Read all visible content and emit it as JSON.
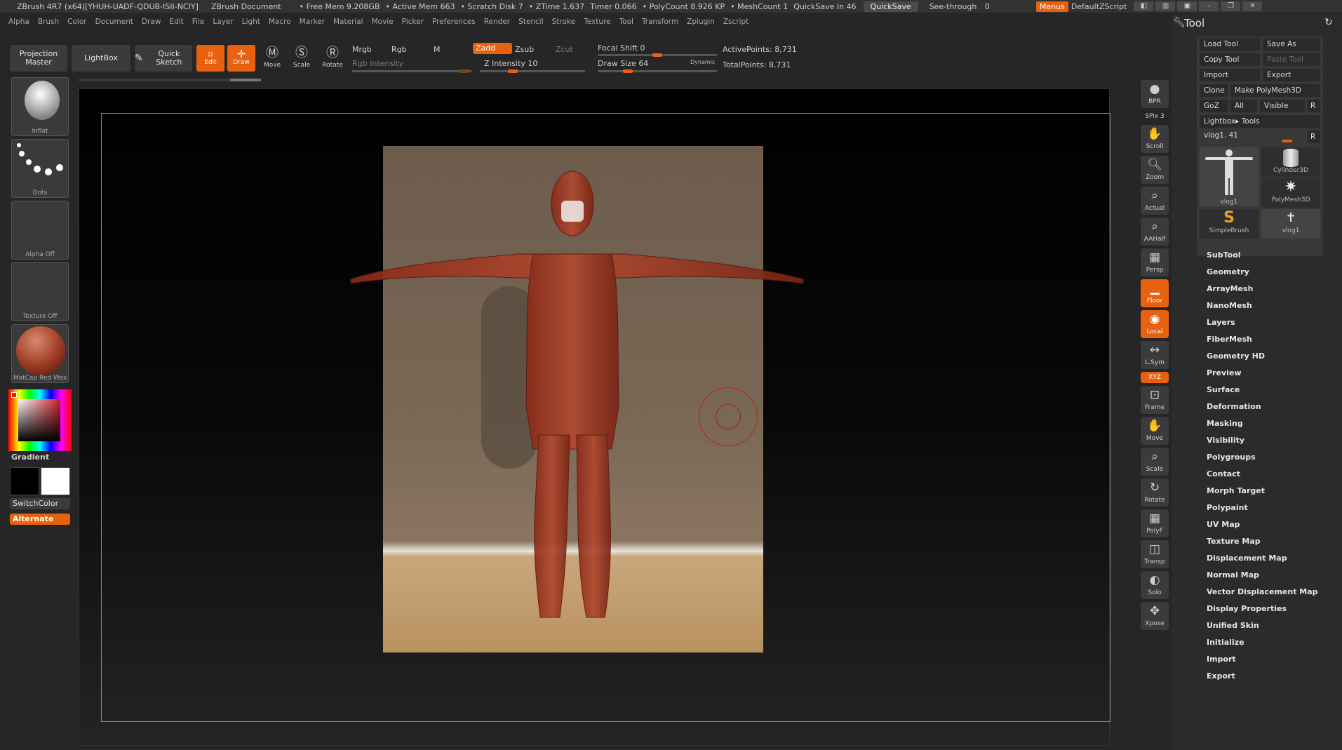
{
  "titlebar": {
    "app": "ZBrush 4R7 (x64)[YHUH-UADF-QDUB-ISII-NCIY]",
    "doc": "ZBrush Document",
    "free_mem": "• Free Mem 9.208GB",
    "active_mem": "• Active Mem 663",
    "scratch": "• Scratch Disk 7",
    "ztime": "• ZTime 1.637",
    "timer": "Timer 0.066",
    "polycount": "• PolyCount 8.926 KP",
    "meshcount": "• MeshCount 1",
    "quicksave_in": "QuickSave In 46",
    "quicksave_btn": "QuickSave",
    "see_through": "See-through",
    "see_through_val": "0",
    "menus_btn": "Menus",
    "zscript": "DefaultZScript"
  },
  "menubar": [
    "Alpha",
    "Brush",
    "Color",
    "Document",
    "Draw",
    "Edit",
    "File",
    "Layer",
    "Light",
    "Macro",
    "Marker",
    "Material",
    "Movie",
    "Picker",
    "Preferences",
    "Render",
    "Stencil",
    "Stroke",
    "Texture",
    "Tool",
    "Transform",
    "Zplugin",
    "Zscript"
  ],
  "shelf": {
    "projection_master": "Projection Master",
    "lightbox": "LightBox",
    "quick_sketch": "Quick Sketch",
    "edit": "Edit",
    "draw": "Draw",
    "move": "Move",
    "scale": "Scale",
    "rotate": "Rotate",
    "mrgb": "Mrgb",
    "rgb": "Rgb",
    "m": "M",
    "rgb_intensity": "Rgb Intensity",
    "zadd": "Zadd",
    "zsub": "Zsub",
    "zcut": "Zcut",
    "z_intensity": "Z Intensity",
    "z_intensity_val": "10",
    "focal_shift": "Focal Shift",
    "focal_shift_val": "0",
    "draw_size": "Draw Size",
    "draw_size_val": "64",
    "dynamic": "Dynamic",
    "active_points": "ActivePoints: 8,731",
    "total_points": "TotalPoints: 8,731"
  },
  "left": {
    "brush_cap": "Inflat",
    "stroke_cap": "Dots",
    "alpha_cap": "Alpha Off",
    "texture_cap": "Texture Off",
    "material_cap": "MatCap Red Wax",
    "gradient": "Gradient",
    "switchcolor": "SwitchColor",
    "alternate": "Alternate"
  },
  "right_strip": [
    {
      "name": "bpr",
      "label": "BPR"
    },
    {
      "name": "spix",
      "label": "SPix 3"
    },
    {
      "name": "scroll",
      "label": "Scroll"
    },
    {
      "name": "zoom",
      "label": "Zoom"
    },
    {
      "name": "actual",
      "label": "Actual"
    },
    {
      "name": "aahalf",
      "label": "AAHalf"
    },
    {
      "name": "persp",
      "label": "Persp"
    },
    {
      "name": "floor",
      "label": "Floor"
    },
    {
      "name": "local",
      "label": "Local"
    },
    {
      "name": "lsym",
      "label": "L.Sym"
    },
    {
      "name": "xyz",
      "label": "XYZ"
    },
    {
      "name": "frame",
      "label": "Frame"
    },
    {
      "name": "move",
      "label": "Move"
    },
    {
      "name": "scale",
      "label": "Scale"
    },
    {
      "name": "rotate",
      "label": "Rotate"
    },
    {
      "name": "polyf",
      "label": "PolyF"
    },
    {
      "name": "transp",
      "label": "Transp"
    },
    {
      "name": "solo",
      "label": "Solo"
    },
    {
      "name": "xpose",
      "label": "Xpose"
    }
  ],
  "toolpanel": {
    "title": "Tool",
    "load_tool": "Load Tool",
    "save_as": "Save As",
    "copy_tool": "Copy Tool",
    "paste_tool": "Paste Tool",
    "import": "Import",
    "export": "Export",
    "clone": "Clone",
    "make_polymesh": "Make PolyMesh3D",
    "goz": "GoZ",
    "all": "All",
    "visible": "Visible",
    "r": "R",
    "lightbox_tools": "Lightbox▸ Tools",
    "current_tool": "vlog1. 41",
    "tools": [
      "vlog1",
      "Cylinder3D",
      "PolyMesh3D",
      "SimpleBrush",
      "vlog1"
    ]
  },
  "menu_list": [
    "SubTool",
    "Geometry",
    "ArrayMesh",
    "NanoMesh",
    "Layers",
    "FiberMesh",
    "Geometry HD",
    "Preview",
    "Surface",
    "Deformation",
    "Masking",
    "Visibility",
    "Polygroups",
    "Contact",
    "Morph Target",
    "Polypaint",
    "UV Map",
    "Texture Map",
    "Displacement Map",
    "Normal Map",
    "Vector Displacement Map",
    "Display Properties",
    "Unified Skin",
    "Initialize",
    "Import",
    "Export"
  ]
}
